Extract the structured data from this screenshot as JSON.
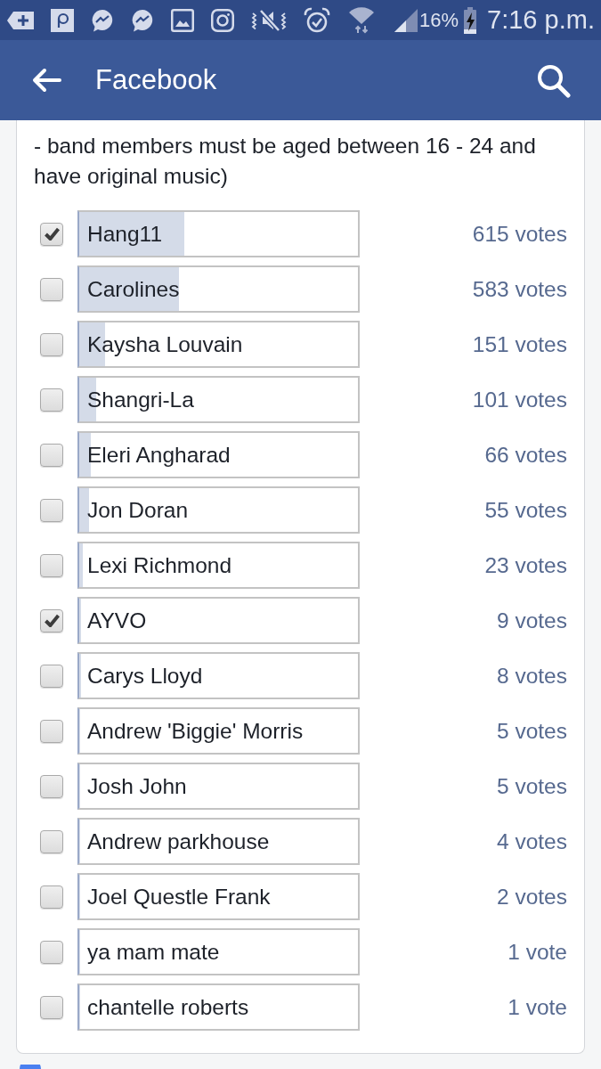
{
  "status_bar": {
    "battery": "16%",
    "time": "7:16 p.m."
  },
  "header": {
    "title": "Facebook"
  },
  "poll": {
    "description": "- band members must be aged between 16 - 24 and have original music)",
    "options": [
      {
        "name": "Hang11",
        "checked": true,
        "level": 0.378,
        "votes": "615 votes"
      },
      {
        "name": "Carolines",
        "checked": false,
        "level": 0.358,
        "votes": "583 votes"
      },
      {
        "name": "Kaysha Louvain",
        "checked": false,
        "level": 0.093,
        "votes": "151 votes"
      },
      {
        "name": "Shangri-La",
        "checked": false,
        "level": 0.062,
        "votes": "101 votes"
      },
      {
        "name": "Eleri Angharad",
        "checked": false,
        "level": 0.041,
        "votes": "66 votes"
      },
      {
        "name": "Jon Doran",
        "checked": false,
        "level": 0.034,
        "votes": "55 votes"
      },
      {
        "name": "Lexi Richmond",
        "checked": false,
        "level": 0.014,
        "votes": "23 votes"
      },
      {
        "name": "AYVO",
        "checked": true,
        "level": 0.006,
        "votes": "9 votes"
      },
      {
        "name": "Carys Lloyd",
        "checked": false,
        "level": 0.005,
        "votes": "8 votes"
      },
      {
        "name": "Andrew 'Biggie' Morris",
        "checked": false,
        "level": 0.003,
        "votes": "5 votes"
      },
      {
        "name": "Josh John",
        "checked": false,
        "level": 0.003,
        "votes": "5 votes"
      },
      {
        "name": "Andrew parkhouse",
        "checked": false,
        "level": 0.002,
        "votes": "4 votes"
      },
      {
        "name": "Joel Questle Frank",
        "checked": false,
        "level": 0.001,
        "votes": "2 votes"
      },
      {
        "name": "ya mam mate",
        "checked": false,
        "level": 0.001,
        "votes": "1 vote"
      },
      {
        "name": "chantelle roberts",
        "checked": false,
        "level": 0.001,
        "votes": "1 vote"
      }
    ]
  }
}
